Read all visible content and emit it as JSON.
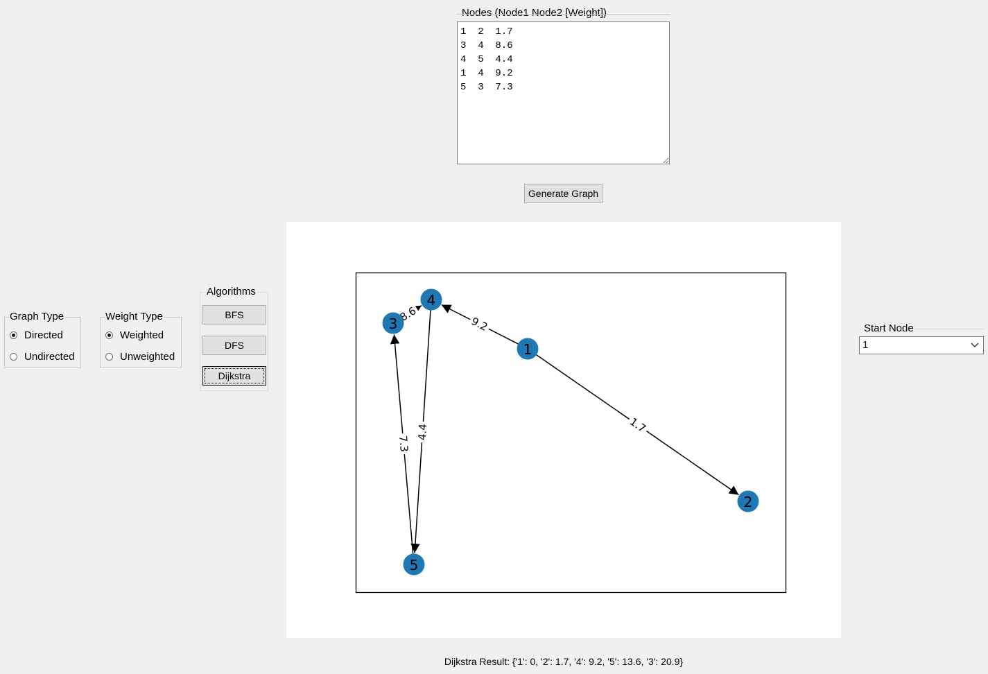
{
  "nodes_input": {
    "legend": "Nodes (Node1 Node2 [Weight])",
    "text": "1  2  1.7\n3  4  8.6\n4  5  4.4\n1  4  9.2\n5  3  7.3"
  },
  "generate_button": "Generate Graph",
  "graph_type": {
    "legend": "Graph Type",
    "options": [
      "Directed",
      "Undirected"
    ],
    "selected": "Directed"
  },
  "weight_type": {
    "legend": "Weight Type",
    "options": [
      "Weighted",
      "Unweighted"
    ],
    "selected": "Weighted"
  },
  "algorithms": {
    "legend": "Algorithms",
    "buttons": [
      "BFS",
      "DFS",
      "Dijkstra"
    ]
  },
  "start_node": {
    "label": "Start Node",
    "value": "1"
  },
  "graph": {
    "node_color": "#1f77b4",
    "nodes": [
      "1",
      "2",
      "3",
      "4",
      "5"
    ],
    "edges": [
      {
        "from": "1",
        "to": "2",
        "weight": "1.7"
      },
      {
        "from": "3",
        "to": "4",
        "weight": "8.6"
      },
      {
        "from": "4",
        "to": "5",
        "weight": "4.4"
      },
      {
        "from": "1",
        "to": "4",
        "weight": "9.2"
      },
      {
        "from": "5",
        "to": "3",
        "weight": "7.3"
      }
    ]
  },
  "result": "Dijkstra Result: {'1': 0, '2': 1.7, '4': 9.2, '5': 13.6, '3': 20.9}"
}
